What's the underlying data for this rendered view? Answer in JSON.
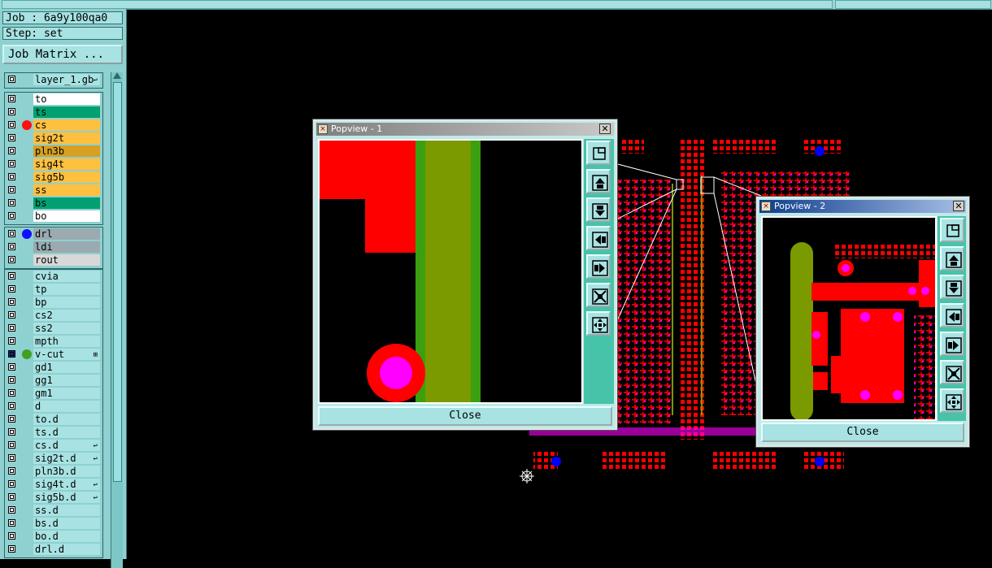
{
  "job": {
    "label": "Job : 6a9y100qa0",
    "step": "Step: set"
  },
  "job_matrix_label": "Job Matrix ...",
  "layers": {
    "top": [
      {
        "name": "layer_1.gb",
        "bg": "#a8e2e2",
        "tag": "↩"
      }
    ],
    "signal": [
      {
        "name": "to",
        "bg": "#ffffff"
      },
      {
        "name": "ts",
        "bg": "#00a070"
      },
      {
        "name": "cs",
        "bg": "#ffc040",
        "dot": "#ff1010"
      },
      {
        "name": "sig2t",
        "bg": "#ffc040"
      },
      {
        "name": "pln3b",
        "bg": "#d8a020"
      },
      {
        "name": "sig4t",
        "bg": "#ffc040"
      },
      {
        "name": "sig5b",
        "bg": "#ffc040"
      },
      {
        "name": "ss",
        "bg": "#ffc040"
      },
      {
        "name": "bs",
        "bg": "#00a070"
      },
      {
        "name": "bo",
        "bg": "#ffffff"
      }
    ],
    "drill": [
      {
        "name": "drl",
        "bg": "#9aaab0",
        "dot": "#1010ff"
      },
      {
        "name": "ldi",
        "bg": "#9aaab0"
      },
      {
        "name": "rout",
        "bg": "#d8d8d8"
      }
    ],
    "misc": [
      {
        "name": "cvia",
        "bg": "#a8e2e2"
      },
      {
        "name": "tp",
        "bg": "#a8e2e2"
      },
      {
        "name": "bp",
        "bg": "#a8e2e2"
      },
      {
        "name": "cs2",
        "bg": "#a8e2e2"
      },
      {
        "name": "ss2",
        "bg": "#a8e2e2"
      },
      {
        "name": "mpth",
        "bg": "#a8e2e2"
      },
      {
        "name": "v-cut",
        "bg": "#a8e2e2",
        "dot": "#40a020",
        "tag": "⊞",
        "selected": true
      },
      {
        "name": "gd1",
        "bg": "#a8e2e2"
      },
      {
        "name": "gg1",
        "bg": "#a8e2e2"
      },
      {
        "name": "gm1",
        "bg": "#a8e2e2"
      },
      {
        "name": "d",
        "bg": "#a8e2e2"
      },
      {
        "name": "to.d",
        "bg": "#a8e2e2"
      },
      {
        "name": "ts.d",
        "bg": "#a8e2e2"
      },
      {
        "name": "cs.d",
        "bg": "#a8e2e2",
        "tag": "↩"
      },
      {
        "name": "sig2t.d",
        "bg": "#a8e2e2",
        "tag": "↩"
      },
      {
        "name": "pln3b.d",
        "bg": "#a8e2e2"
      },
      {
        "name": "sig4t.d",
        "bg": "#a8e2e2",
        "tag": "↩"
      },
      {
        "name": "sig5b.d",
        "bg": "#a8e2e2",
        "tag": "↩"
      },
      {
        "name": "ss.d",
        "bg": "#a8e2e2"
      },
      {
        "name": "bs.d",
        "bg": "#a8e2e2"
      },
      {
        "name": "bo.d",
        "bg": "#a8e2e2"
      },
      {
        "name": "drl.d",
        "bg": "#a8e2e2"
      }
    ]
  },
  "popview1": {
    "title": "Popview - 1",
    "close_label": "Close"
  },
  "popview2": {
    "title": "Popview - 2",
    "close_label": "Close"
  },
  "tool_icons": [
    "zoom-home-icon",
    "pan-up-icon",
    "pan-down-icon",
    "pan-left-icon",
    "pan-right-icon",
    "zoom-in-icon",
    "zoom-out-icon"
  ],
  "colors": {
    "copper": "#ff0000",
    "pad": "#ff00ff",
    "drill": "#0000ff",
    "vcut": "#7a9a00",
    "panel": "#8fd0d0"
  }
}
